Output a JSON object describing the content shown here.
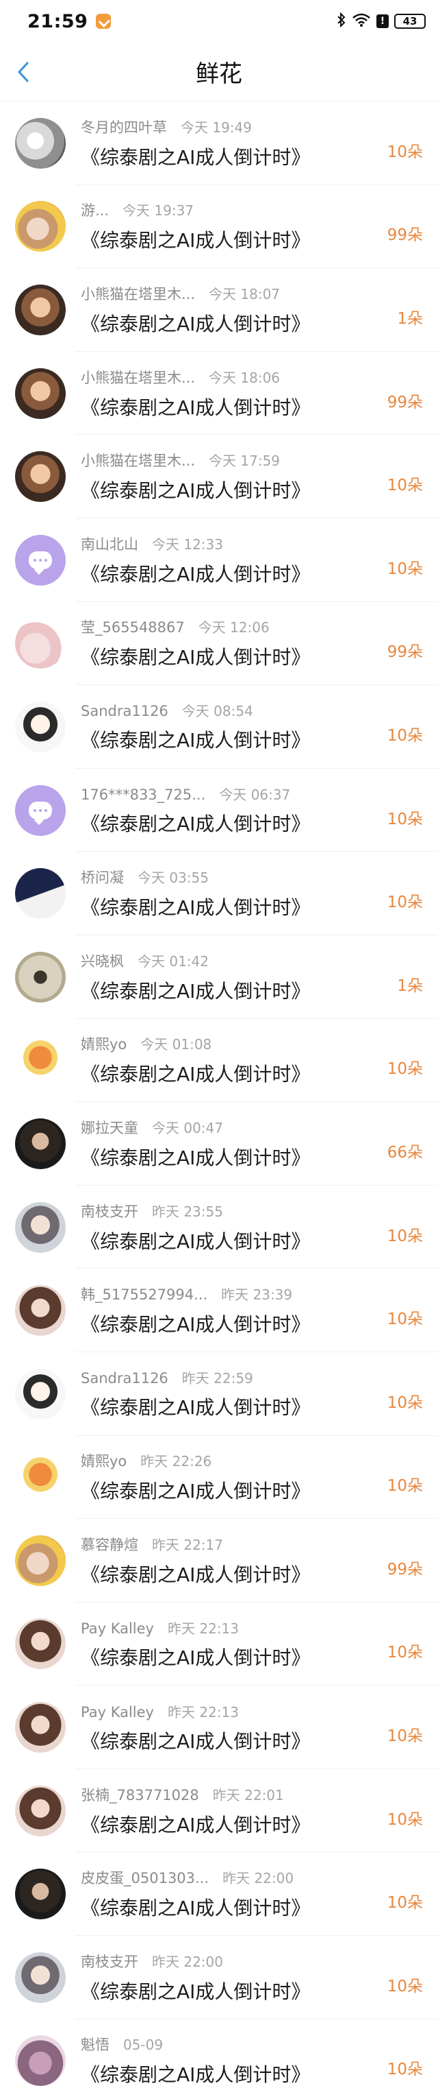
{
  "status_bar": {
    "time": "21:59",
    "alert": "!",
    "battery": "43"
  },
  "header": {
    "title": "鲜花"
  },
  "book_title": "《综泰剧之AI成人倒计时》",
  "rows": [
    {
      "nick": "冬月的四叶草",
      "when": "今天 19:49",
      "count": "10朵",
      "avatar": "cat"
    },
    {
      "nick": "游...",
      "when": "今天 19:37",
      "count": "99朵",
      "avatar": "girl1"
    },
    {
      "nick": "小熊猫在塔里木...",
      "when": "今天 18:07",
      "count": "1朵",
      "avatar": "baby"
    },
    {
      "nick": "小熊猫在塔里木...",
      "when": "今天 18:06",
      "count": "99朵",
      "avatar": "baby"
    },
    {
      "nick": "小熊猫在塔里木...",
      "when": "今天 17:59",
      "count": "10朵",
      "avatar": "baby"
    },
    {
      "nick": "南山北山",
      "when": "今天 12:33",
      "count": "10朵",
      "avatar": "purple"
    },
    {
      "nick": "莹_565548867",
      "when": "今天 12:06",
      "count": "99朵",
      "avatar": "pink"
    },
    {
      "nick": "Sandra1126",
      "when": "今天 08:54",
      "count": "10朵",
      "avatar": "anime"
    },
    {
      "nick": "176***833_725...",
      "when": "今天 06:37",
      "count": "10朵",
      "avatar": "purple"
    },
    {
      "nick": "桥问凝",
      "when": "今天 03:55",
      "count": "10朵",
      "avatar": "night"
    },
    {
      "nick": "兴晓枫",
      "when": "今天 01:42",
      "count": "1朵",
      "avatar": "fan"
    },
    {
      "nick": "婧熙yo",
      "when": "今天 01:08",
      "count": "10朵",
      "avatar": "tiger"
    },
    {
      "nick": "娜拉天童",
      "when": "今天 00:47",
      "count": "66朵",
      "avatar": "dark"
    },
    {
      "nick": "南枝支开",
      "when": "昨天 23:55",
      "count": "10朵",
      "avatar": "boy"
    },
    {
      "nick": "韩_5175527994...",
      "when": "昨天 23:39",
      "count": "10朵",
      "avatar": "woman"
    },
    {
      "nick": "Sandra1126",
      "when": "昨天 22:59",
      "count": "10朵",
      "avatar": "anime"
    },
    {
      "nick": "婧熙yo",
      "when": "昨天 22:26",
      "count": "10朵",
      "avatar": "tiger"
    },
    {
      "nick": "慕容静煊",
      "when": "昨天 22:17",
      "count": "99朵",
      "avatar": "girl1"
    },
    {
      "nick": "Pay Kalley",
      "when": "昨天 22:13",
      "count": "10朵",
      "avatar": "woman"
    },
    {
      "nick": "Pay Kalley",
      "when": "昨天 22:13",
      "count": "10朵",
      "avatar": "woman"
    },
    {
      "nick": "张楠_783771028",
      "when": "昨天 22:01",
      "count": "10朵",
      "avatar": "woman"
    },
    {
      "nick": "皮皮蛋_0501303...",
      "when": "昨天 22:00",
      "count": "10朵",
      "avatar": "dark"
    },
    {
      "nick": "南枝支开",
      "when": "昨天 22:00",
      "count": "10朵",
      "avatar": "boy"
    },
    {
      "nick": "魁悟",
      "when": "05-09",
      "count": "10朵",
      "avatar": "sakura"
    }
  ],
  "colors": {
    "accent": "#e8873d",
    "back_arrow": "#3a8ee6",
    "badge": "#f39c3c"
  }
}
